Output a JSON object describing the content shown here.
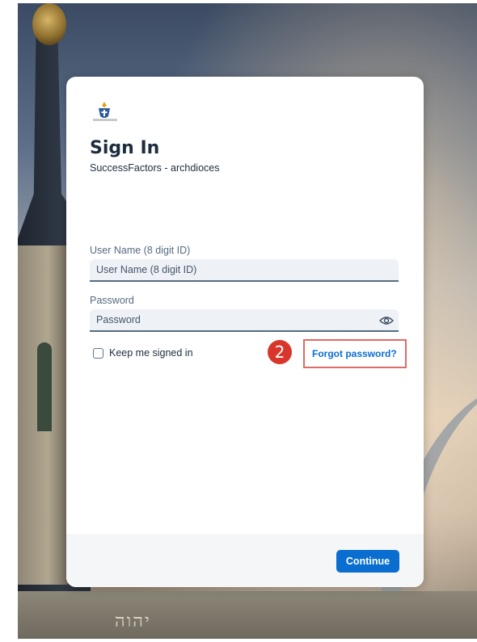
{
  "signin": {
    "title": "Sign In",
    "subtitle": "SuccessFactors - archdioces",
    "username_label": "User Name (8 digit ID)",
    "username_placeholder": "User Name (8 digit ID)",
    "password_label": "Password",
    "password_placeholder": "Password",
    "keep_signed_in_label": "Keep me signed in",
    "keep_signed_in_checked": false,
    "forgot_password_label": "Forgot password?",
    "continue_label": "Continue"
  },
  "annotation": {
    "step_number": "2"
  },
  "background": {
    "facade_text": "יהוה"
  },
  "icons": {
    "logo": "archdiocese-logo-icon",
    "show_password": "eye-icon"
  },
  "colors": {
    "primary": "#0a6ed1",
    "title_text": "#1d2d3e",
    "badge": "#d9362b",
    "highlight_border": "#e06b66"
  }
}
